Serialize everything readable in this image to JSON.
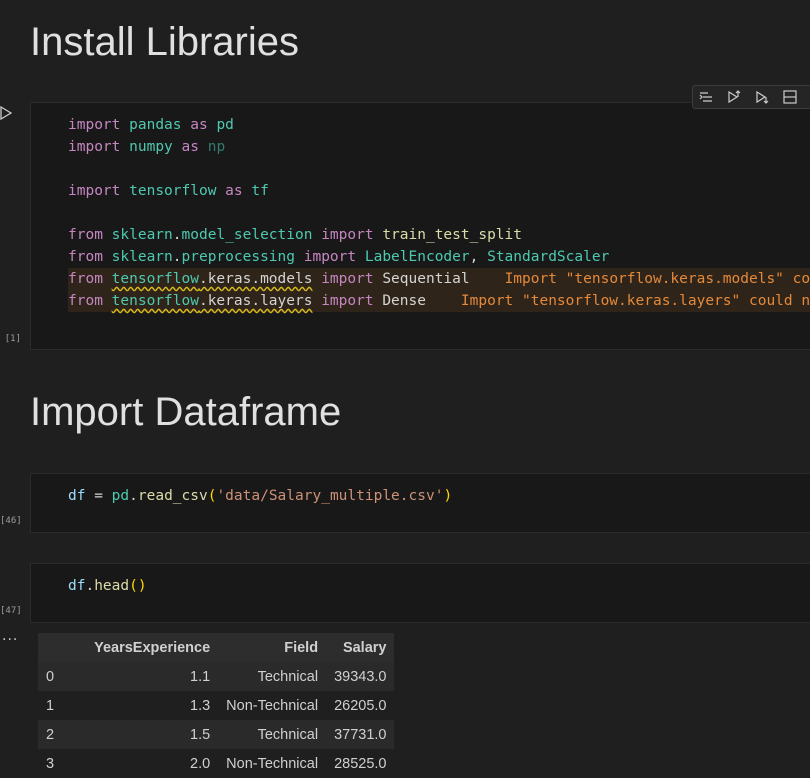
{
  "headings": {
    "install": "Install Libraries",
    "import_df": "Import Dataframe"
  },
  "cell1": {
    "exec_count": "[1]",
    "warnings": {
      "models": "Import \"tensorflow.keras.models\" co",
      "layers": "Import \"tensorflow.keras.layers\" could n"
    }
  },
  "cell2": {
    "exec_count": "[46]"
  },
  "cell3": {
    "exec_count": "[47]"
  },
  "output": {
    "more": "...",
    "table": {
      "columns": [
        "",
        "YearsExperience",
        "Field",
        "Salary"
      ],
      "rows": [
        [
          "0",
          "1.1",
          "Technical",
          "39343.0"
        ],
        [
          "1",
          "1.3",
          "Non-Technical",
          "26205.0"
        ],
        [
          "2",
          "1.5",
          "Technical",
          "37731.0"
        ],
        [
          "3",
          "2.0",
          "Non-Technical",
          "28525.0"
        ]
      ]
    }
  }
}
